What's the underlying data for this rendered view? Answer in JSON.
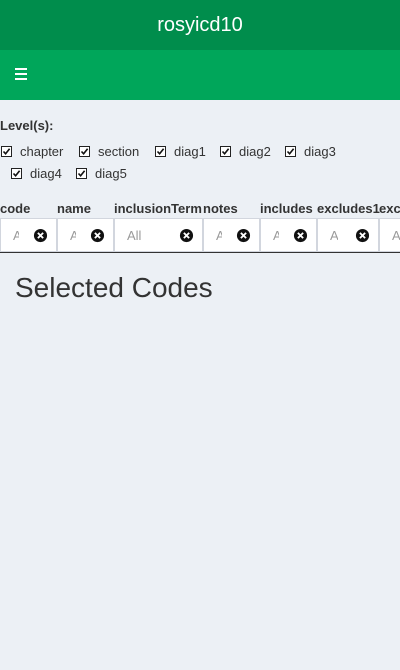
{
  "header": {
    "app_title": "rosyicd10"
  },
  "levels": {
    "label": "Level(s):",
    "options": [
      {
        "label": "chapter",
        "checked": true
      },
      {
        "label": "section",
        "checked": true
      },
      {
        "label": "diag1",
        "checked": true
      },
      {
        "label": "diag2",
        "checked": true
      },
      {
        "label": "diag3",
        "checked": true
      },
      {
        "label": "diag4",
        "checked": true
      },
      {
        "label": "diag5",
        "checked": true
      }
    ]
  },
  "filters": {
    "columns": [
      {
        "header": "code",
        "placeholder": "All"
      },
      {
        "header": "name",
        "placeholder": "All"
      },
      {
        "header": "inclusionTerm",
        "placeholder": "All"
      },
      {
        "header": "notes",
        "placeholder": "All"
      },
      {
        "header": "includes",
        "placeholder": "All"
      },
      {
        "header": "excludes1",
        "placeholder": "All"
      },
      {
        "header": "exc",
        "placeholder": "All"
      }
    ]
  },
  "main": {
    "section_title": "Selected Codes"
  }
}
